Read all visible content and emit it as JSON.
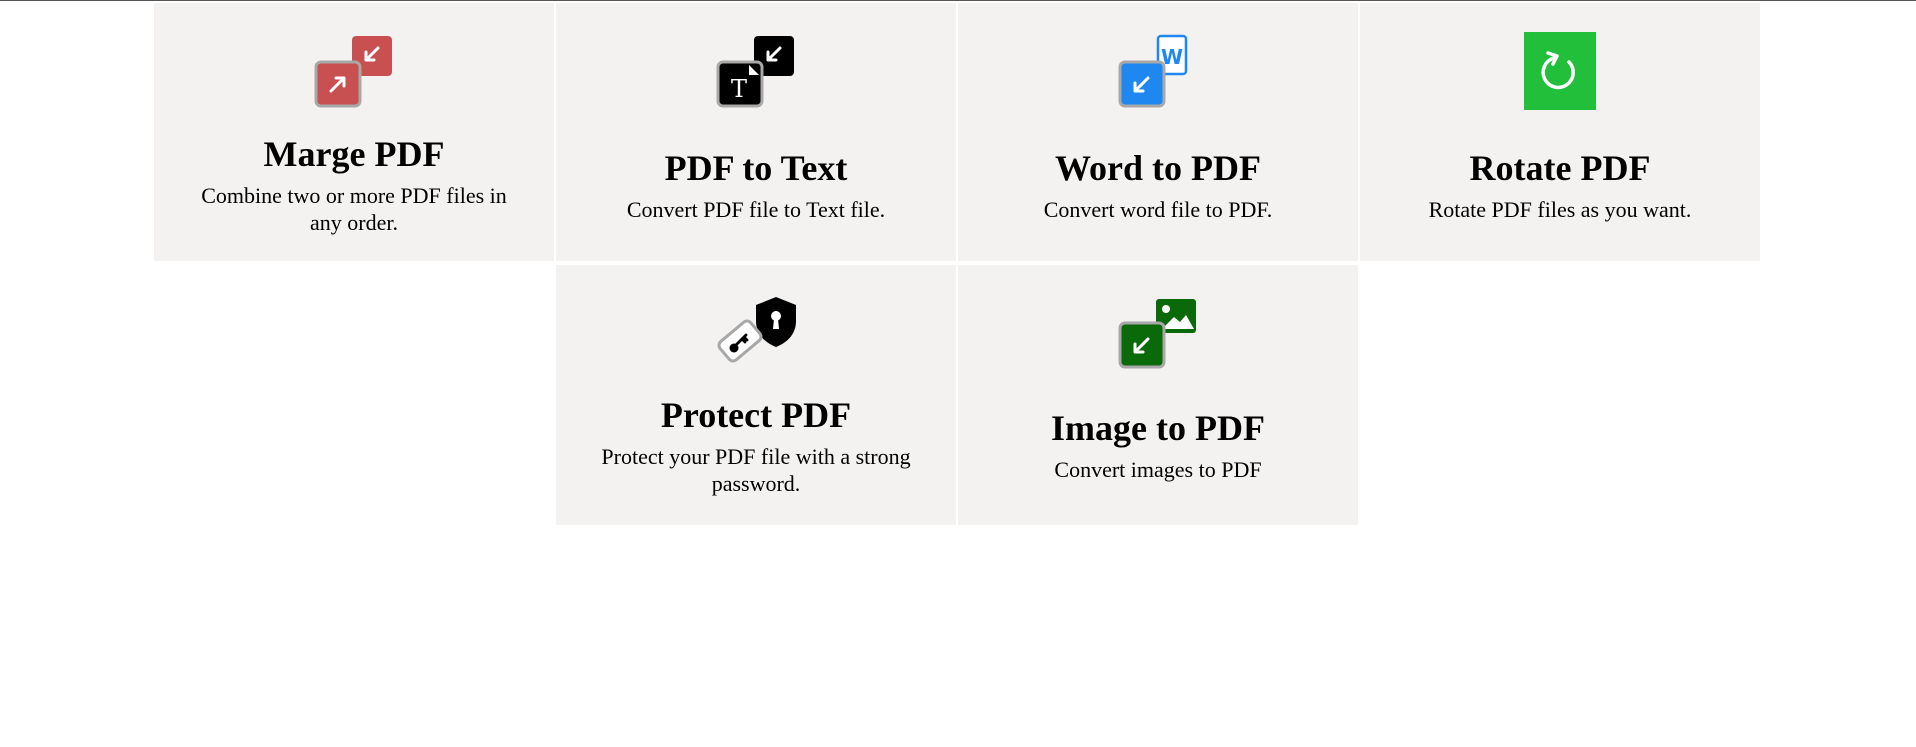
{
  "tools": [
    {
      "id": "merge",
      "title": "Marge PDF",
      "desc": "Combine two or more PDF files in any order.",
      "icon": "merge-pdf-icon",
      "color": "#c85050"
    },
    {
      "id": "pdf-to-text",
      "title": "PDF to Text",
      "desc": "Convert PDF file to Text file.",
      "icon": "pdf-to-text-icon",
      "color": "#000000"
    },
    {
      "id": "word-to-pdf",
      "title": "Word to PDF",
      "desc": "Convert word file to PDF.",
      "icon": "word-to-pdf-icon",
      "color": "#1e88f0"
    },
    {
      "id": "rotate",
      "title": "Rotate PDF",
      "desc": "Rotate PDF files as you want.",
      "icon": "rotate-icon",
      "color": "#22c03a"
    },
    {
      "id": "protect",
      "title": "Protect PDF",
      "desc": "Protect your PDF file with a strong password.",
      "icon": "protect-pdf-icon",
      "color": "#000000"
    },
    {
      "id": "image-to-pdf",
      "title": "Image to PDF",
      "desc": "Convert images to PDF",
      "icon": "image-to-pdf-icon",
      "color": "#0a6a0a"
    }
  ],
  "colors": {
    "card_bg": "#f3f2f0",
    "page_bg": "#ffffff"
  }
}
